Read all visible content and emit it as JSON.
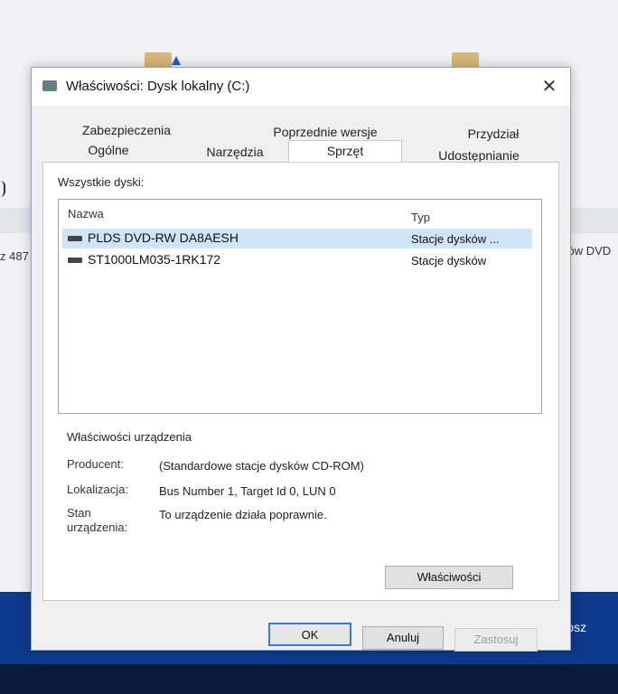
{
  "background": {
    "left_text": "z 487",
    "right_text": "ców DVD",
    "taskbar_button": "Kosz"
  },
  "dialog": {
    "title": "Właściwości: Dysk lokalny (C:)",
    "close_glyph": "✕",
    "tabs_row1": [
      "Zabezpieczenia",
      "Poprzednie wersje",
      "Przydział"
    ],
    "tabs_row2": [
      "Ogólne",
      "Narzędzia",
      "Sprzęt",
      "Udostępnianie"
    ],
    "active_tab": "Sprzęt"
  },
  "hardware": {
    "all_disks_label": "Wszystkie dyski:",
    "columns": {
      "name": "Nazwa",
      "type": "Typ"
    },
    "rows": [
      {
        "name": "PLDS DVD-RW DA8AESH",
        "type": "Stacje dysków ...",
        "selected": true
      },
      {
        "name": "ST1000LM035-1RK172",
        "type": "Stacje dysków",
        "selected": false
      }
    ],
    "device_properties": {
      "heading": "Właściwości urządzenia",
      "manufacturer_label": "Producent:",
      "manufacturer_value": "(Standardowe stacje dysków CD-ROM)",
      "location_label": "Lokalizacja:",
      "location_value": "Bus Number 1, Target Id 0, LUN 0",
      "status_label_line1": "Stan",
      "status_label_line2": "urządzenia:",
      "status_value": "To urządzenie działa poprawnie."
    },
    "properties_button": "Właściwości"
  },
  "footer": {
    "ok": "OK",
    "cancel": "Anuluj",
    "apply": "Zastosuj"
  },
  "colors": {
    "selection": "#cfe4f6",
    "default_button_border": "#3a7bd5",
    "taskbar": "#0d3a8a"
  }
}
